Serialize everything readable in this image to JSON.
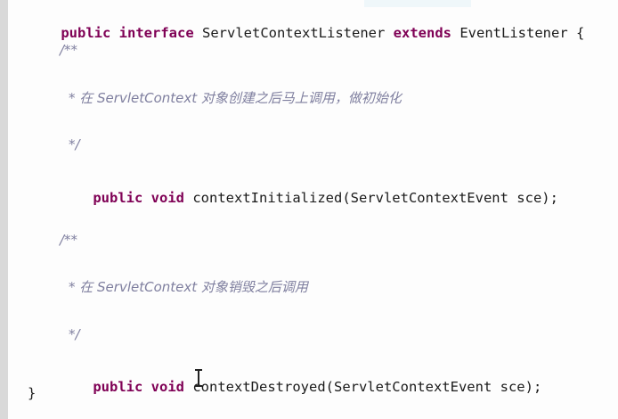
{
  "code": {
    "line1": {
      "kw1": "public",
      "kw2": "interface",
      "name": "ServletContextListener",
      "kw3": "extends",
      "parent": "EventListener {"
    },
    "comment1": {
      "open": "/**",
      "text": "* 在 ServletContext 对象创建之后马上调用，做初始化",
      "close": "*/"
    },
    "method1": {
      "kw1": "public",
      "kw2": "void",
      "signature": "contextInitialized(ServletContextEvent sce);"
    },
    "comment2": {
      "open": "/**",
      "text": "* 在 ServletContext 对象销毁之后调用",
      "close": "*/"
    },
    "method2": {
      "kw1": "public",
      "kw2": "void",
      "signature": "contextDestroyed(ServletContextEvent sce);"
    },
    "closing_brace": "}"
  }
}
